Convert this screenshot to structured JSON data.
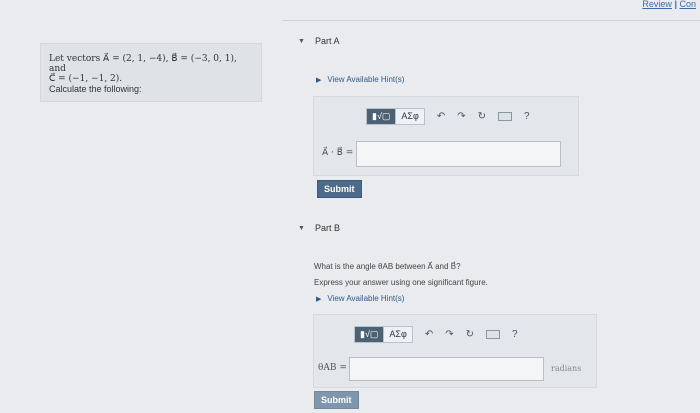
{
  "topbar": {
    "review": "Review",
    "separator": "|",
    "contact": "Con"
  },
  "problem": {
    "line1": "Let vectors A⃗ = (2, 1, −4), B⃗ = (−3, 0, 1), and",
    "line2": "C⃗ = (−1, −1, 2).",
    "line3": "Calculate the following:"
  },
  "partA": {
    "title": "Part A",
    "hint": "View Available Hint(s)",
    "toolbar": {
      "templates": "▮√▢",
      "symbols": "ΑΣφ",
      "undo": "↶",
      "redo": "↷",
      "reset": "↻",
      "keyboard": "keyboard-icon",
      "help": "?"
    },
    "label": "A⃗ · B⃗ =",
    "value": "",
    "submit": "Submit"
  },
  "partB": {
    "title": "Part B",
    "question": "What is the angle θAB between A⃗ and B⃗?",
    "instruction": "Express your answer using one significant figure.",
    "hint": "View Available Hint(s)",
    "toolbar": {
      "templates": "▮√▢",
      "symbols": "ΑΣφ",
      "undo": "↶",
      "redo": "↷",
      "reset": "↻",
      "keyboard": "keyboard-icon",
      "help": "?"
    },
    "label": "θAB =",
    "value": "",
    "units": "radians",
    "submit": "Submit"
  }
}
